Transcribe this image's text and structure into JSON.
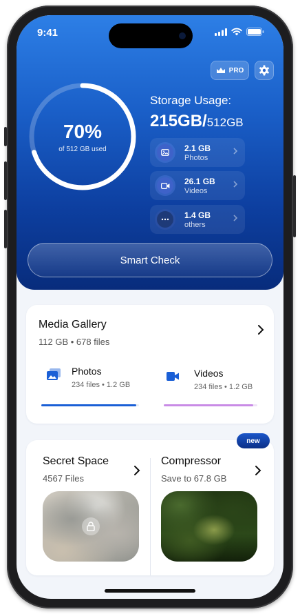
{
  "status_bar": {
    "time": "9:41"
  },
  "header": {
    "pro_label": "PRO"
  },
  "storage": {
    "percent_label": "70%",
    "used_fraction": 0.7,
    "ring_caption": "of 512 GB used",
    "title": "Storage Usage:",
    "used": "215GB/",
    "total": "512GB",
    "categories": [
      {
        "size": "2.1 GB",
        "label": "Photos",
        "icon": "image-icon"
      },
      {
        "size": "26.1 GB",
        "label": "Videos",
        "icon": "video-icon"
      },
      {
        "size": "1.4 GB",
        "label": "others",
        "icon": "more-icon"
      }
    ]
  },
  "smart_check": {
    "label": "Smart Check"
  },
  "media_gallery": {
    "title": "Media Gallery",
    "summary": "112 GB • 678 files",
    "items": [
      {
        "name": "Photos",
        "meta": "234 files • 1.2 GB",
        "color": "#1a5fd6"
      },
      {
        "name": "Videos",
        "meta": "234 files • 1.2 GB",
        "color": "#c98be6"
      }
    ]
  },
  "tools": {
    "new_badge": "new",
    "secret_space": {
      "title": "Secret Space",
      "subtitle": "4567 Files"
    },
    "compressor": {
      "title": "Compressor",
      "subtitle": "Save to 67.8 GB"
    }
  },
  "colors": {
    "accent": "#1a5fd6",
    "hero_top": "#2d7fe6",
    "hero_bottom": "#082c7c"
  }
}
